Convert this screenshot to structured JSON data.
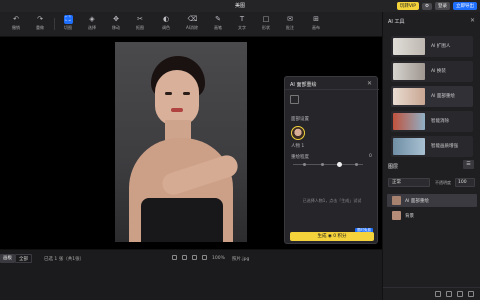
{
  "window": {
    "title": "美图",
    "buttons": [
      "玩转VIP",
      "登录",
      "立即导出"
    ]
  },
  "toolbar": {
    "items": [
      {
        "label": "撤销",
        "icon": "undo-icon",
        "glyph": "↶"
      },
      {
        "label": "重做",
        "icon": "redo-icon",
        "glyph": "↷"
      },
      {
        "label": "切图",
        "icon": "crop-icon",
        "glyph": "⛶"
      },
      {
        "label": "选择",
        "icon": "select-icon",
        "glyph": "◈",
        "active": true
      },
      {
        "label": "移动",
        "icon": "move-icon",
        "glyph": "✥"
      },
      {
        "label": "抠图",
        "icon": "cutout-icon",
        "glyph": "✂"
      },
      {
        "label": "调色",
        "icon": "palette-icon",
        "glyph": "◐"
      },
      {
        "label": "AI消除",
        "icon": "eraser-icon",
        "glyph": "⌫"
      },
      {
        "label": "画笔",
        "icon": "brush-icon",
        "glyph": "✎"
      },
      {
        "label": "文字",
        "icon": "text-icon",
        "glyph": "T"
      },
      {
        "label": "形状",
        "icon": "shape-icon",
        "glyph": "□"
      },
      {
        "label": "批注",
        "icon": "comment-icon",
        "glyph": "✉"
      },
      {
        "label": "画布",
        "icon": "canvas-icon",
        "glyph": "⊞"
      }
    ]
  },
  "dialog": {
    "title": "AI 面部重绘",
    "face_section": "面部设置",
    "person_label": "人物 1",
    "strength_label": "重绘程度",
    "strength_max": "0",
    "hint": "已选择人物1，点击「生成」试试",
    "generate_label": "生成 ◉ 0 积分",
    "badge": "限时免费"
  },
  "side": {
    "title": "AI 工具",
    "tools": [
      {
        "label": "AI 扩图人",
        "thumb": "#c9c7c4"
      },
      {
        "label": "AI 换装",
        "thumb": "#b8b2ad"
      },
      {
        "label": "AI 面部重绘",
        "thumb": "#d7c7bc"
      },
      {
        "label": "智能消除",
        "thumb": "#9a4b3a"
      },
      {
        "label": "智能画质增强",
        "thumb": "#7f9ab0"
      }
    ],
    "layers_title": "图层",
    "blend_mode": "正常",
    "opacity_label": "不透明度",
    "opacity_value": "100",
    "layers": [
      {
        "label": "AI 面部重绘",
        "selected": true,
        "thumb": "#a7826f"
      },
      {
        "label": "背景",
        "selected": false,
        "thumb": "#b48c78"
      }
    ]
  },
  "bottom": {
    "tab_a": "画板",
    "tab_b": "全部",
    "status": "已选 1 张（共1张）",
    "zoom": "100%",
    "filename": "照片.jpg"
  },
  "colors": {
    "accent_blue": "#1f6fff",
    "accent_yellow": "#f3d23b"
  }
}
